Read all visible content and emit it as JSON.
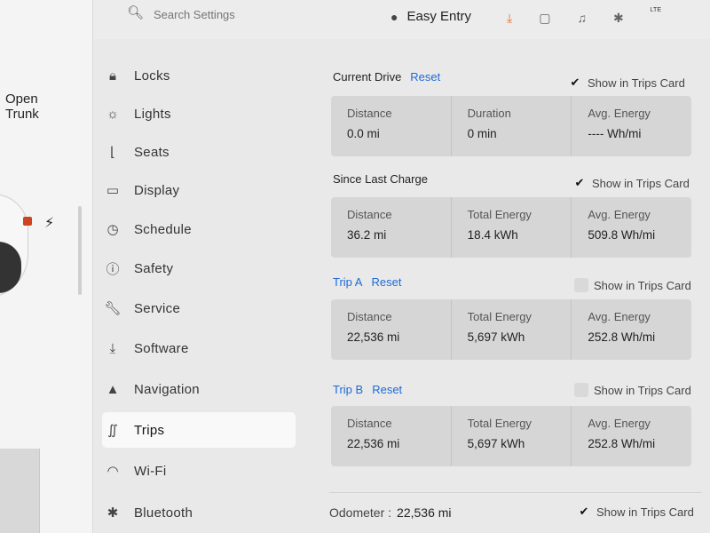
{
  "vehicle": {
    "open_trunk_line1": "Open",
    "open_trunk_line2": "Trunk"
  },
  "topbar": {
    "search_placeholder": "Search Settings",
    "profile_name": "Easy Entry",
    "lte_label": "LTE"
  },
  "nav": {
    "items": [
      {
        "label": "Locks",
        "icon": "lock-icon"
      },
      {
        "label": "Lights",
        "icon": "light-icon"
      },
      {
        "label": "Seats",
        "icon": "seat-icon"
      },
      {
        "label": "Display",
        "icon": "display-icon"
      },
      {
        "label": "Schedule",
        "icon": "clock-icon"
      },
      {
        "label": "Safety",
        "icon": "safety-icon"
      },
      {
        "label": "Service",
        "icon": "wrench-icon"
      },
      {
        "label": "Software",
        "icon": "download-icon"
      },
      {
        "label": "Navigation",
        "icon": "navigation-icon"
      },
      {
        "label": "Trips",
        "icon": "trips-icon",
        "active": true
      },
      {
        "label": "Wi-Fi",
        "icon": "wifi-icon"
      },
      {
        "label": "Bluetooth",
        "icon": "bluetooth-icon"
      }
    ]
  },
  "sections": {
    "current_drive": {
      "title": "Current Drive",
      "reset": "Reset",
      "show_label": "Show in Trips Card",
      "checked": true,
      "cells": [
        {
          "label": "Distance",
          "value": "0.0  mi"
        },
        {
          "label": "Duration",
          "value": "0  min"
        },
        {
          "label": "Avg. Energy",
          "value": "---- Wh/mi"
        }
      ]
    },
    "since_last_charge": {
      "title": "Since Last Charge",
      "show_label": "Show in Trips Card",
      "checked": true,
      "cells": [
        {
          "label": "Distance",
          "value": "36.2  mi"
        },
        {
          "label": "Total Energy",
          "value": "18.4  kWh"
        },
        {
          "label": "Avg. Energy",
          "value": "509.8  Wh/mi"
        }
      ]
    },
    "trip_a": {
      "title": "Trip A",
      "reset": "Reset",
      "show_label": "Show in Trips Card",
      "checked": false,
      "cells": [
        {
          "label": "Distance",
          "value": "22,536  mi"
        },
        {
          "label": "Total Energy",
          "value": "5,697  kWh"
        },
        {
          "label": "Avg. Energy",
          "value": "252.8  Wh/mi"
        }
      ]
    },
    "trip_b": {
      "title": "Trip B",
      "reset": "Reset",
      "show_label": "Show in Trips Card",
      "checked": false,
      "cells": [
        {
          "label": "Distance",
          "value": "22,536  mi"
        },
        {
          "label": "Total Energy",
          "value": "5,697  kWh"
        },
        {
          "label": "Avg. Energy",
          "value": "252.8  Wh/mi"
        }
      ]
    },
    "odometer": {
      "label": "Odometer :",
      "value": "22,536  mi",
      "show_label": "Show in Trips Card",
      "checked": true
    }
  },
  "colors": {
    "accent": "#1e6ad6",
    "download": "#e8712b",
    "background": "#e9e9e9",
    "card": "#d6d6d6"
  }
}
